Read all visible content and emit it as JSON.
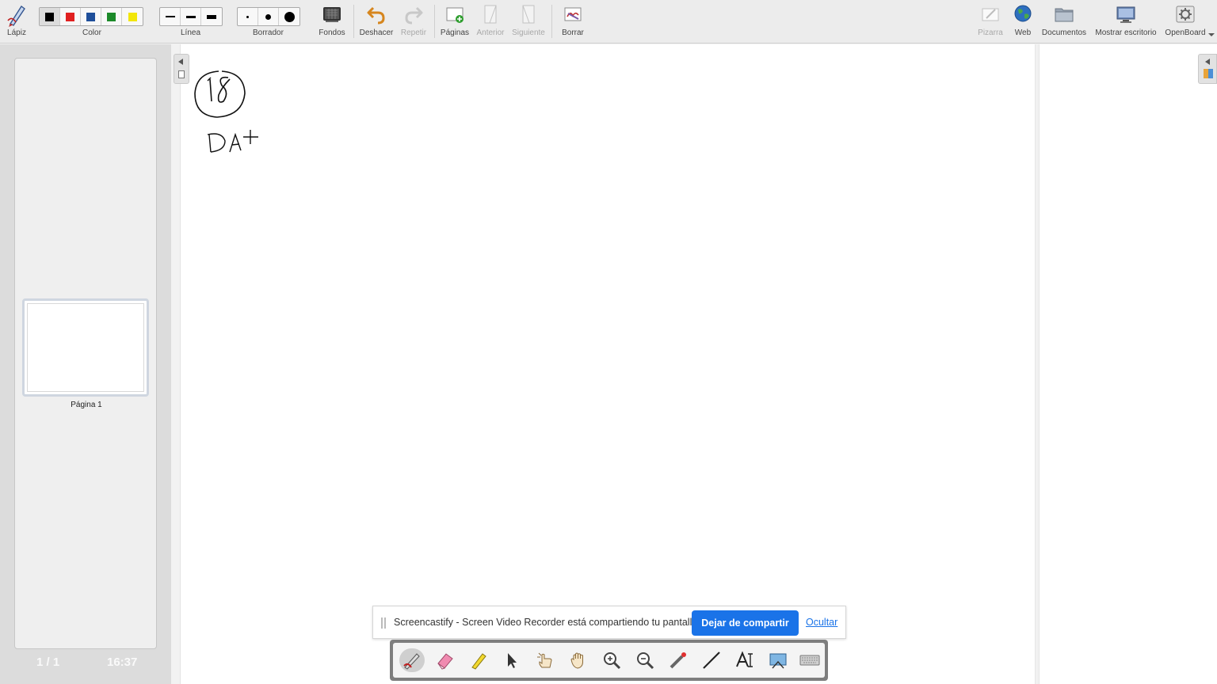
{
  "toolbar": {
    "lapiz": "Lápiz",
    "color": "Color",
    "linea": "Línea",
    "borrador": "Borrador",
    "fondos": "Fondos",
    "deshacer": "Deshacer",
    "repetir": "Repetir",
    "paginas": "Páginas",
    "anterior": "Anterior",
    "siguiente": "Siguiente",
    "borrar": "Borrar",
    "pizarra": "Pizarra",
    "web": "Web",
    "documentos": "Documentos",
    "mostrar_escritorio": "Mostrar escritorio",
    "openboard": "OpenBoard"
  },
  "colors": [
    "#000000",
    "#e02020",
    "#1f4f9a",
    "#1c8a2a",
    "#f2e60a"
  ],
  "sidebar": {
    "page_label": "Página 1",
    "page_count": "1 / 1",
    "clock": "16:37"
  },
  "banner": {
    "message": "Screencastify - Screen Video Recorder está compartiendo tu pantalla.",
    "stop_label": "Dejar de compartir",
    "hide_label": "Ocultar"
  },
  "palette": {
    "tools": [
      "pen-icon",
      "eraser-icon",
      "highlighter-icon",
      "pointer-icon",
      "interact-icon",
      "hand-icon",
      "zoom-in-icon",
      "zoom-out-icon",
      "laser-icon",
      "line-icon",
      "text-icon",
      "capture-icon",
      "keyboard-icon"
    ]
  }
}
